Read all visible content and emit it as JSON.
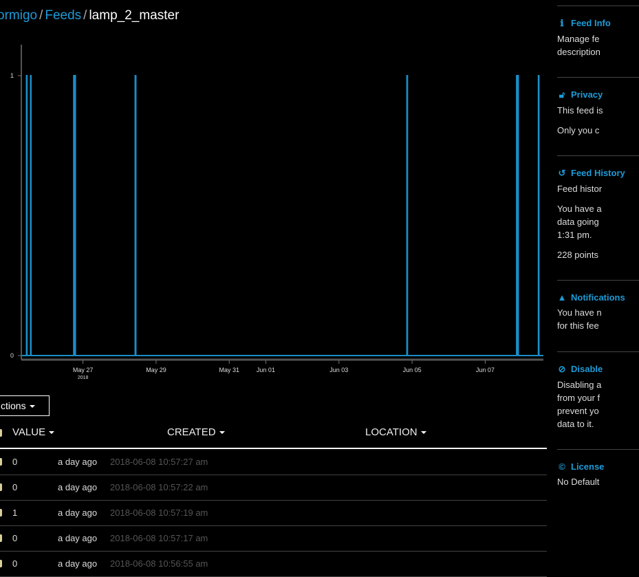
{
  "breadcrumb": {
    "owner": "ormigo",
    "feeds": "Feeds",
    "feed": "lamp_2_master",
    "separator": "/"
  },
  "chart_data": {
    "type": "line",
    "step": true,
    "x_axis": {
      "ticks": [
        "May 27",
        "May 29",
        "May 31",
        "Jun 01",
        "Jun 03",
        "Jun 05",
        "Jun 07"
      ],
      "tick_dates": [
        "2018-05-27",
        "2018-05-29",
        "2018-05-31",
        "2018-06-01",
        "2018-06-03",
        "2018-06-05",
        "2018-06-07"
      ],
      "year_label": "2018",
      "range": [
        "2018-05-25T08:00",
        "2018-06-08T14:10"
      ]
    },
    "y_axis": {
      "ticks": [
        "0",
        "1"
      ],
      "range": [
        0,
        1
      ]
    },
    "color": "#1a8ec8",
    "spikes_to_1": [
      {
        "start": "2018-05-25T11:00",
        "end": "2018-05-25T11:10"
      },
      {
        "start": "2018-05-25T13:40",
        "end": "2018-05-25T13:50"
      },
      {
        "start": "2018-05-26T18:00",
        "end": "2018-05-26T19:00"
      },
      {
        "start": "2018-05-28T10:20",
        "end": "2018-05-28T10:40"
      },
      {
        "start": "2018-06-04T20:40",
        "end": "2018-06-04T20:45"
      },
      {
        "start": "2018-06-07T20:40",
        "end": "2018-06-07T21:40"
      },
      {
        "start": "2018-06-08T10:57",
        "end": "2018-06-08T10:58"
      }
    ]
  },
  "actions_label": "ctions",
  "table": {
    "headers": {
      "value": "VALUE",
      "created": "CREATED",
      "location": "LOCATION"
    },
    "rows": [
      {
        "value": "0",
        "ago": "a day ago",
        "ts": "2018-06-08 10:57:27 am"
      },
      {
        "value": "0",
        "ago": "a day ago",
        "ts": "2018-06-08 10:57:22 am"
      },
      {
        "value": "1",
        "ago": "a day ago",
        "ts": "2018-06-08 10:57:19 am"
      },
      {
        "value": "0",
        "ago": "a day ago",
        "ts": "2018-06-08 10:57:17 am"
      },
      {
        "value": "0",
        "ago": "a day ago",
        "ts": "2018-06-08 10:56:55 am"
      }
    ]
  },
  "sidebar": {
    "info": {
      "title": "Feed Info",
      "lines": [
        "Manage fe",
        "description"
      ]
    },
    "privacy": {
      "title": "Privacy",
      "lines": [
        "This feed is",
        "Only you c"
      ]
    },
    "history": {
      "title": "Feed History",
      "lines": [
        "Feed histor",
        "You have a",
        "data going",
        "1:31 pm.",
        "228 points"
      ]
    },
    "notifications": {
      "title": "Notifications",
      "lines": [
        "You have n",
        "for this fee"
      ]
    },
    "disable": {
      "title": "Disable",
      "lines": [
        "Disabling a",
        "from your f",
        "prevent yo",
        "data to it."
      ]
    },
    "license": {
      "title": "License",
      "lines": [
        "No Default"
      ]
    }
  }
}
